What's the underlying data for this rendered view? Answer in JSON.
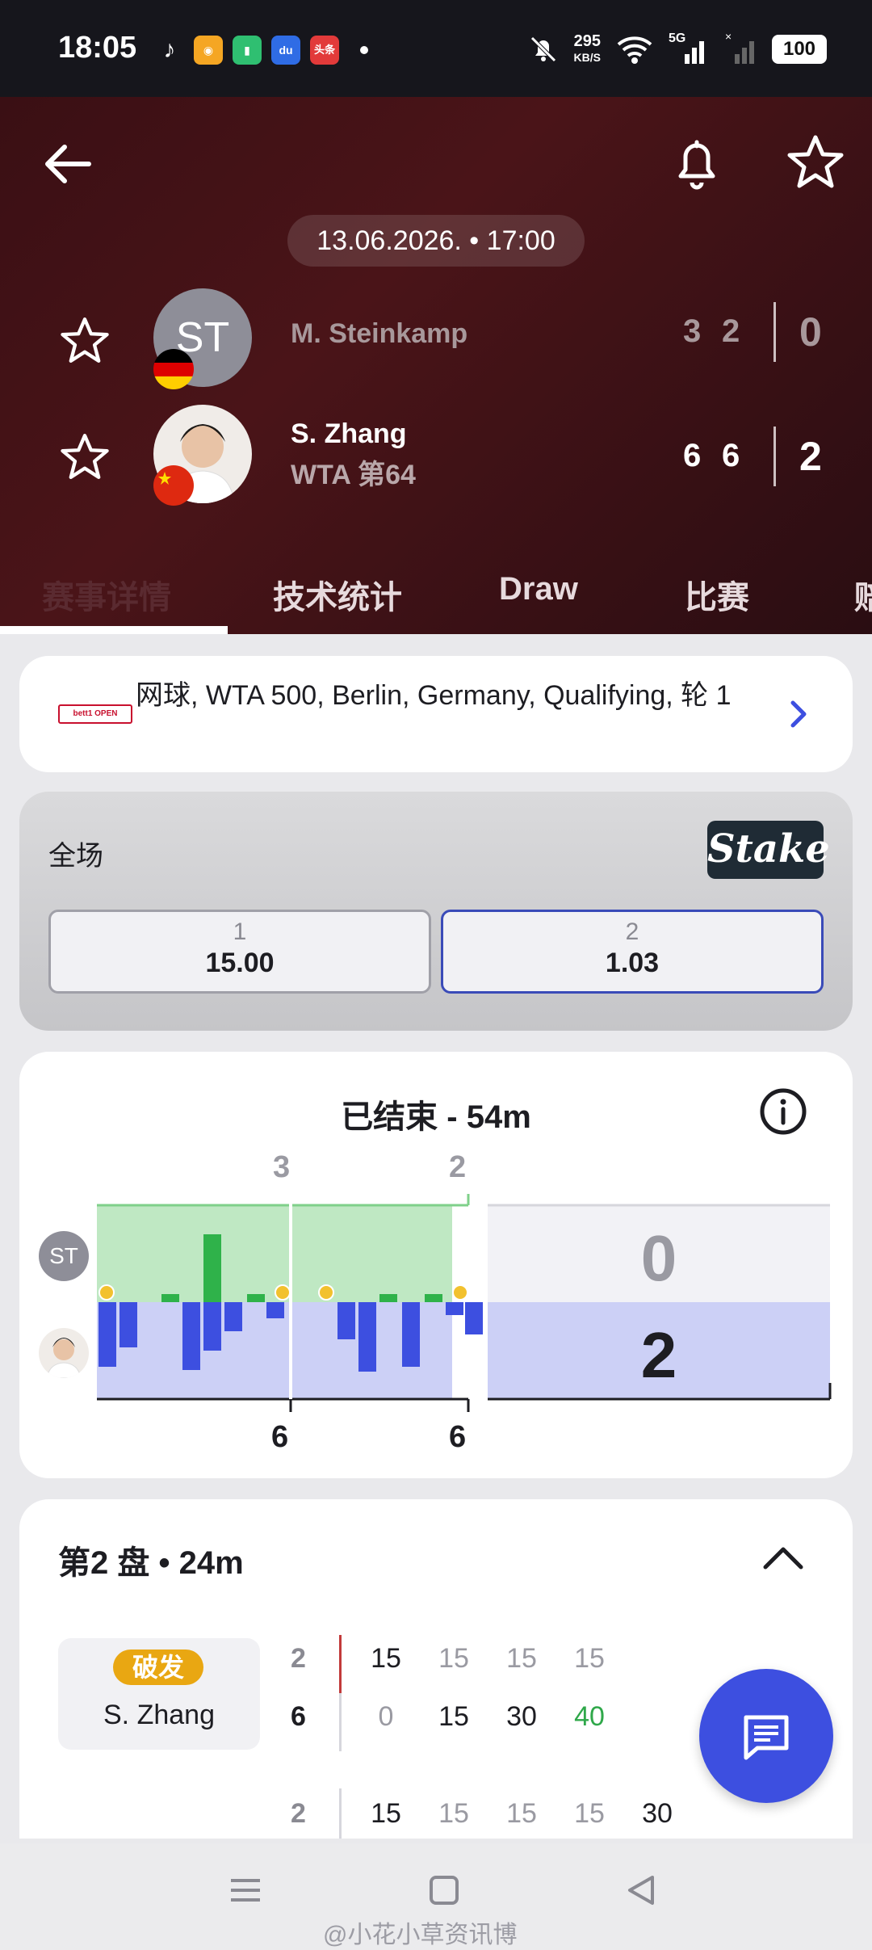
{
  "status_bar": {
    "time": "18:05",
    "apps": [
      "tiktok-icon",
      "weibo-icon",
      "battery-app-icon",
      "baidu-icon",
      "toutiao-icon"
    ],
    "toutiao_label": "头条",
    "net_speed": "295",
    "net_unit": "KB/S",
    "network": "5G",
    "battery": "100"
  },
  "header": {
    "back_icon": "arrow-left-icon",
    "bell_icon": "bell-icon",
    "fav_icon": "star-icon",
    "date": "13.06.2026. • 17:00",
    "player1": {
      "initials": "ST",
      "name": "M. Steinkamp",
      "games": [
        "3",
        "2"
      ],
      "sets": "0",
      "flag": "Germany"
    },
    "player2": {
      "name": "S. Zhang",
      "rank": "WTA 第64",
      "games": [
        "6",
        "6"
      ],
      "sets": "2",
      "flag": "China"
    },
    "tabs": [
      {
        "label": "赛事详情",
        "active": true
      },
      {
        "label": "技术统计"
      },
      {
        "label": "Draw"
      },
      {
        "label": "比赛"
      },
      {
        "label": "赔"
      }
    ]
  },
  "competition": {
    "logo": "bett1 OPEN",
    "text": "网球, WTA 500, Berlin, Germany, Qualifying, 轮 1"
  },
  "odds": {
    "title": "全场",
    "bookmaker": "Stake",
    "options": [
      {
        "label": "1",
        "value": "15.00",
        "selected": false
      },
      {
        "label": "2",
        "value": "1.03",
        "selected": true
      }
    ]
  },
  "momentum": {
    "title": "已结束 - 54m",
    "top_set_scores": [
      "3",
      "2"
    ],
    "bottom_set_scores": [
      "6",
      "6"
    ],
    "player1_initials": "ST",
    "sets_won": {
      "player1": "0",
      "player2": "2"
    },
    "colors": {
      "player1": "#bfe8c3",
      "player2": "#ccd0f6",
      "bar": "#3d4fe0"
    }
  },
  "set_detail": {
    "title": "第2 盘 • 24m",
    "break_label": "破发",
    "server": "S. Zhang",
    "rows": [
      {
        "games": [
          "2",
          "6"
        ],
        "points_top": [
          "15",
          "15",
          "15",
          "15"
        ],
        "points_bottom": [
          "0",
          "15",
          "30",
          "40"
        ]
      },
      {
        "games": [
          "2"
        ],
        "points_top": [
          "15",
          "15",
          "15",
          "15",
          "30"
        ]
      }
    ]
  },
  "fab_icon": "chat-icon",
  "watermark": "@小花小草资讯博",
  "nav": [
    "menu-icon",
    "home-icon",
    "back-triangle-icon"
  ]
}
